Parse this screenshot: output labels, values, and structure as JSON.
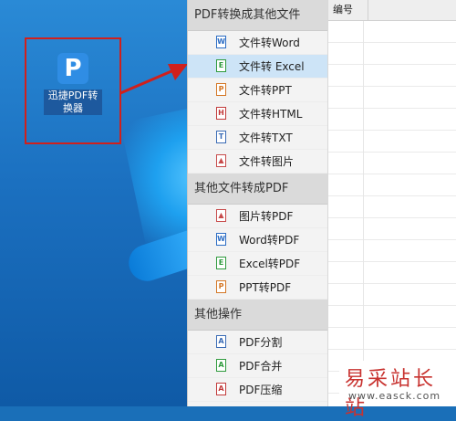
{
  "desktop": {
    "icon_glyph": "P",
    "icon_label": "迅捷PDF转换器",
    "highlight_color": "#d0201c"
  },
  "menu": {
    "groups": [
      {
        "header": "PDF转换成其他文件",
        "items": [
          {
            "label": "文件转Word",
            "icon": "word-doc-icon",
            "glyph": "W",
            "color": "#2b6cc4"
          },
          {
            "label": "文件转 Excel",
            "icon": "excel-doc-icon",
            "glyph": "E",
            "color": "#2e9a3c",
            "selected": true
          },
          {
            "label": "文件转PPT",
            "icon": "ppt-doc-icon",
            "glyph": "P",
            "color": "#d47624"
          },
          {
            "label": "文件转HTML",
            "icon": "html-doc-icon",
            "glyph": "H",
            "color": "#c23a3a"
          },
          {
            "label": "文件转TXT",
            "icon": "txt-doc-icon",
            "glyph": "T",
            "color": "#3a6bb5"
          },
          {
            "label": "文件转图片",
            "icon": "image-doc-icon",
            "glyph": "▲",
            "color": "#c74a4a"
          }
        ]
      },
      {
        "header": "其他文件转成PDF",
        "items": [
          {
            "label": "图片转PDF",
            "icon": "image-doc-icon",
            "glyph": "▲",
            "color": "#c74a4a"
          },
          {
            "label": "Word转PDF",
            "icon": "word-doc-icon",
            "glyph": "W",
            "color": "#2b6cc4"
          },
          {
            "label": "Excel转PDF",
            "icon": "excel-doc-icon",
            "glyph": "E",
            "color": "#2e9a3c"
          },
          {
            "label": "PPT转PDF",
            "icon": "ppt-doc-icon",
            "glyph": "P",
            "color": "#d47624"
          }
        ]
      },
      {
        "header": "其他操作",
        "items": [
          {
            "label": "PDF分割",
            "icon": "pdf-split-icon",
            "glyph": "A",
            "color": "#3a6bb5"
          },
          {
            "label": "PDF合并",
            "icon": "pdf-merge-icon",
            "glyph": "A",
            "color": "#2e9a3c"
          },
          {
            "label": "PDF压缩",
            "icon": "pdf-compress-icon",
            "glyph": "A",
            "color": "#c23a3a"
          }
        ]
      }
    ]
  },
  "table": {
    "column_header": "编号"
  },
  "watermark": {
    "title": "易采站长站",
    "url": "www.easck.com"
  }
}
